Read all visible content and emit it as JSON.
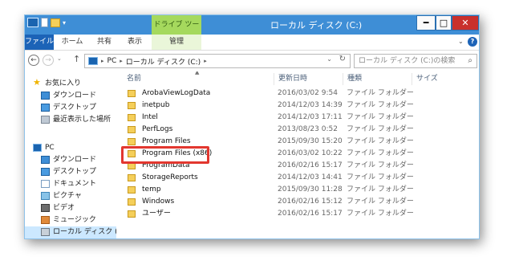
{
  "window": {
    "title": "ローカル ディスク (C:)",
    "context_group": "ドライブ ツール",
    "minimize_glyph": "━",
    "maximize_glyph": "□",
    "close_glyph": "✕"
  },
  "ribbon": {
    "tabs": [
      "ファイル",
      "ホーム",
      "共有",
      "表示",
      "管理"
    ],
    "chevron_glyph": "⌄",
    "help_glyph": "?"
  },
  "navigation": {
    "back_glyph": "←",
    "forward_glyph": "→",
    "recent_glyph": "⌄",
    "up_glyph": "↑",
    "breadcrumb": [
      "PC",
      "ローカル ディスク (C:)"
    ],
    "separator_glyph": "▸",
    "dropdown_glyph": "⌄",
    "refresh_glyph": "↻",
    "search_placeholder": "ローカル ディスク (C:)の検索",
    "search_glyph": "⌕"
  },
  "sidebar": {
    "items": [
      {
        "label": "お気に入り",
        "icon": "star-icon"
      },
      {
        "label": "ダウンロード",
        "icon": "download-folder-icon"
      },
      {
        "label": "デスクトップ",
        "icon": "desktop-folder-icon"
      },
      {
        "label": "最近表示した場所",
        "icon": "recent-places-icon"
      },
      {
        "label": "PC",
        "icon": "pc-icon"
      },
      {
        "label": "ダウンロード",
        "icon": "download-folder-icon"
      },
      {
        "label": "デスクトップ",
        "icon": "desktop-folder-icon"
      },
      {
        "label": "ドキュメント",
        "icon": "documents-folder-icon"
      },
      {
        "label": "ピクチャ",
        "icon": "pictures-folder-icon"
      },
      {
        "label": "ビデオ",
        "icon": "videos-folder-icon"
      },
      {
        "label": "ミュージック",
        "icon": "music-folder-icon"
      },
      {
        "label": "ローカル ディスク (C:)",
        "icon": "drive-icon"
      }
    ]
  },
  "list": {
    "sort_glyph": "▲",
    "columns": [
      "名前",
      "更新日時",
      "種類",
      "サイズ"
    ],
    "rows": [
      {
        "name": "ArobaViewLogData",
        "date": "2016/03/02 9:54",
        "type": "ファイル フォルダー"
      },
      {
        "name": "inetpub",
        "date": "2014/12/03 14:39",
        "type": "ファイル フォルダー"
      },
      {
        "name": "Intel",
        "date": "2014/12/03 17:11",
        "type": "ファイル フォルダー"
      },
      {
        "name": "PerfLogs",
        "date": "2013/08/23 0:52",
        "type": "ファイル フォルダー"
      },
      {
        "name": "Program Files",
        "date": "2015/09/30 15:20",
        "type": "ファイル フォルダー"
      },
      {
        "name": "Program Files (x86)",
        "date": "2016/03/02 10:22",
        "type": "ファイル フォルダー"
      },
      {
        "name": "ProgramData",
        "date": "2016/02/16 15:17",
        "type": "ファイル フォルダー"
      },
      {
        "name": "StorageReports",
        "date": "2014/12/03 14:41",
        "type": "ファイル フォルダー"
      },
      {
        "name": "temp",
        "date": "2015/09/30 11:28",
        "type": "ファイル フォルダー"
      },
      {
        "name": "Windows",
        "date": "2016/02/16 15:12",
        "type": "ファイル フォルダー"
      },
      {
        "name": "ユーザー",
        "date": "2016/02/16 15:17",
        "type": "ファイル フォルダー"
      }
    ]
  },
  "colors": {
    "titlebar": "#3e8ed6",
    "file_tab": "#1c63b7",
    "context_group": "#a5d95d",
    "highlight_border": "#e2372f",
    "folder": "#f5cf5a"
  }
}
